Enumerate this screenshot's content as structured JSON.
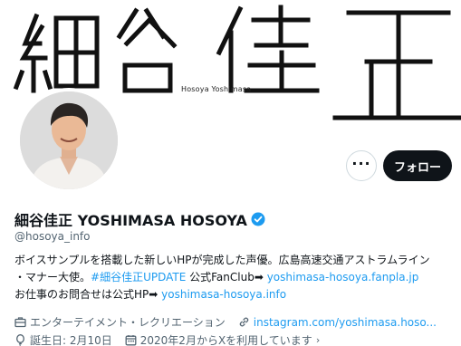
{
  "banner": {
    "title_chars": [
      "細",
      "谷",
      "佳",
      "正"
    ],
    "subtitle": "Hosoya Yoshimasa"
  },
  "actions": {
    "more_label": "···",
    "follow_label": "フォロー"
  },
  "profile": {
    "display_name": "細谷佳正 YOSHIMASA HOSOYA",
    "handle": "@hosoya_info",
    "verified": true
  },
  "bio": {
    "line1": "ボイスサンプルを搭載した新しいHPが完成した声優。広島高速交通アストラムライン",
    "line2_prefix": "・マナー大使。",
    "line2_hashtag": "#細谷佳正UPDATE",
    "line2_mid": " 公式FanClub➡ ",
    "line2_link": "yoshimasa-hosoya.fanpla.jp",
    "line3_prefix": "お仕事のお問合せは公式HP➡ ",
    "line3_link": "yoshimasa-hosoya.info"
  },
  "meta": {
    "category": "エンターテイメント・レクリエーション",
    "website": "instagram.com/yoshimasa.hoso...",
    "birthday": "誕生日: 2月10日",
    "joined": "2020年2月からXを利用しています",
    "joined_chevron": "›"
  },
  "colors": {
    "accent": "#1d9bf0",
    "text": "#0f1419",
    "muted": "#536471",
    "follow_bg": "#0f1419"
  }
}
